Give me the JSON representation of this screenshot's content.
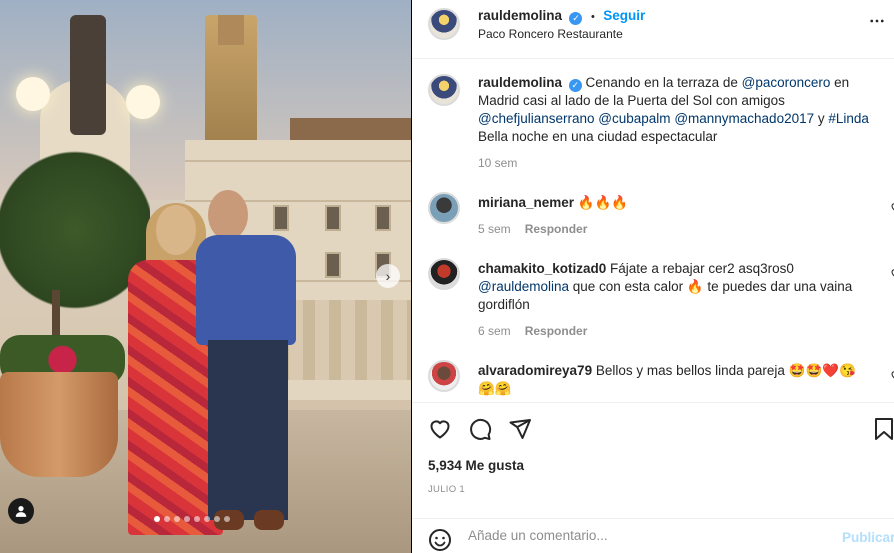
{
  "post": {
    "author": "rauldemolina",
    "verified_mark": "✓",
    "follow_separator": "•",
    "follow_label": "Seguir",
    "location": "Paco Roncero Restaurante",
    "more_icon": "more-horizontal-icon",
    "caption": {
      "username": "rauldemolina",
      "text_1": " Cenando en la terraza de ",
      "mention_1": "@pacoroncero",
      "text_2": " en Madrid casi al lado de la Puerta del Sol con amigos ",
      "mention_2": "@chefjulianserrano",
      "text_3": " ",
      "mention_3": "@cubapalm",
      "text_4": " ",
      "mention_4": "@mannymachado2017",
      "text_5": " y ",
      "mention_5": "#Linda",
      "line_2": "Bella noche en una ciudad espectacular",
      "time": "10 sem"
    },
    "comments": [
      {
        "username": "miriana_nemer",
        "text": " 🔥🔥🔥",
        "time": "5 sem",
        "reply_label": "Responder"
      },
      {
        "username": "chamakito_kotizad0",
        "text_1": " Fájate a rebajar cer2 asq3ros0 ",
        "mention": "@rauldemolina",
        "text_2": " que con esta calor 🔥 te puedes dar una vaina gordiflón",
        "time": "6 sem",
        "reply_label": "Responder"
      },
      {
        "username": "alvaradomireya79",
        "text": " Bellos y mas bellos linda pareja 🤩🤩❤️😘",
        "text_2": "🤗🤗"
      }
    ],
    "likes": "5,934 Me gusta",
    "date": "JULIO 1",
    "add_comment_placeholder": "Añade un comentario...",
    "publish_label": "Publicar"
  },
  "carousel": {
    "next_icon": "›",
    "total_slides": 8,
    "active_slide": 1
  },
  "colors": {
    "follow_blue": "#0095f6",
    "verified_blue": "#3897f0",
    "mention_blue": "#00376b",
    "muted_gray": "#8e8e8e",
    "publish_disabled": "#b2dffc"
  }
}
